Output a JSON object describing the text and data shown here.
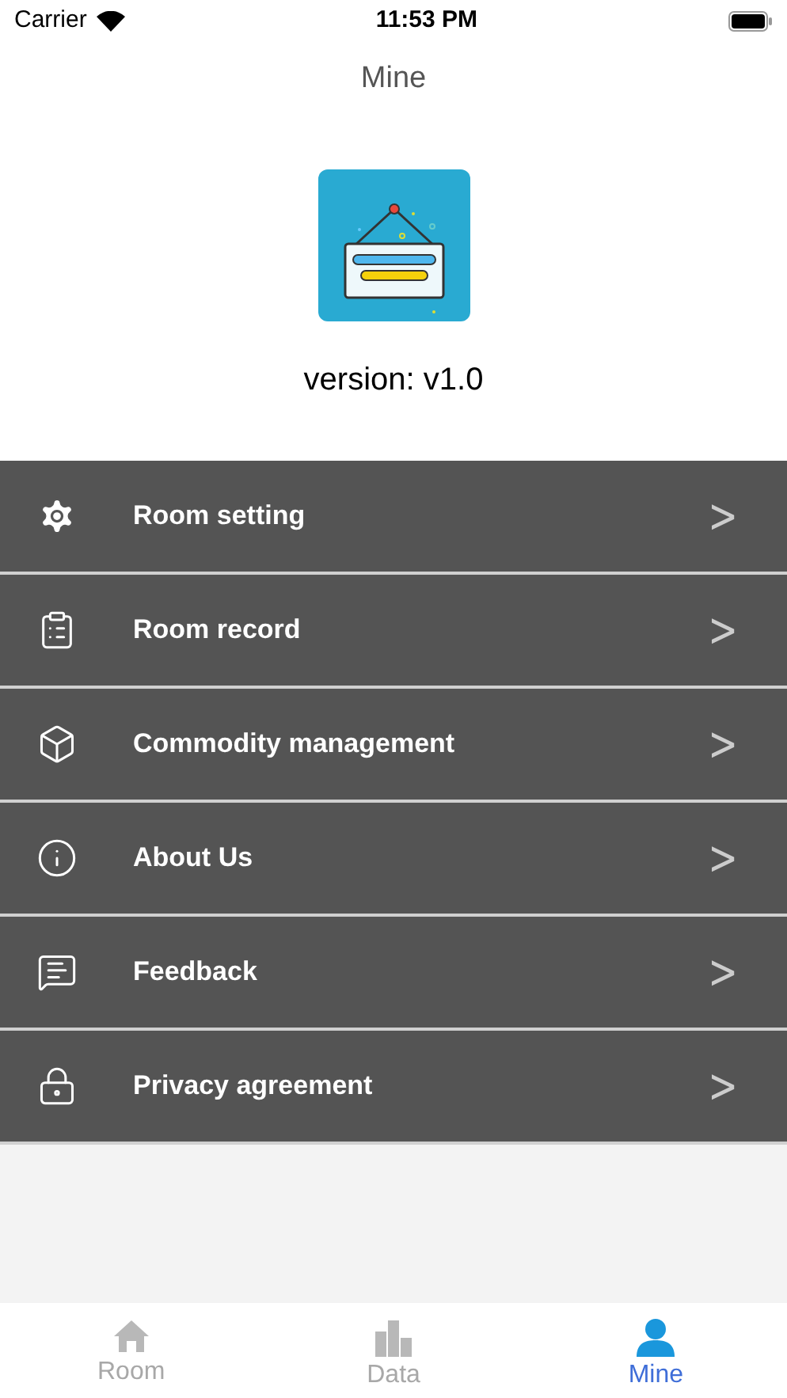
{
  "status_bar": {
    "carrier": "Carrier",
    "time": "11:53 PM"
  },
  "nav": {
    "title": "Mine"
  },
  "app_info": {
    "version": "version: v1.0"
  },
  "menu": [
    {
      "kind": "gear",
      "label": "Room setting",
      "chevron": ">"
    },
    {
      "kind": "clipboard",
      "label": "Room record",
      "chevron": ">"
    },
    {
      "kind": "box",
      "label": "Commodity management",
      "chevron": ">"
    },
    {
      "kind": "info",
      "label": "About Us",
      "chevron": ">"
    },
    {
      "kind": "message",
      "label": "Feedback",
      "chevron": ">"
    },
    {
      "kind": "lock",
      "label": "Privacy agreement",
      "chevron": ">"
    }
  ],
  "tab_bar": [
    {
      "kind": "home",
      "label": "Room",
      "selected": false
    },
    {
      "kind": "chart",
      "label": "Data",
      "selected": false
    },
    {
      "kind": "person",
      "label": "Mine",
      "selected": true
    }
  ]
}
